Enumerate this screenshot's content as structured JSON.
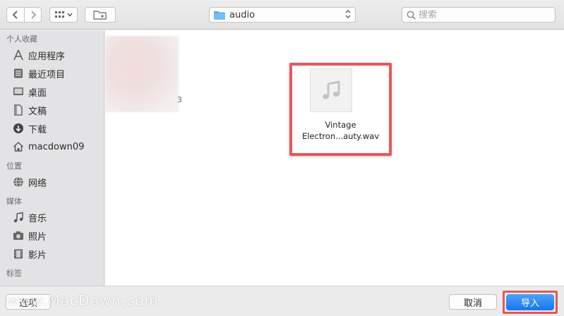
{
  "toolbar": {
    "back_icon": "chevron-left-icon",
    "forward_icon": "chevron-right-icon",
    "view_icon": "grid-view-icon",
    "new_folder_icon": "new-folder-icon",
    "location": "audio",
    "search_placeholder": "搜索"
  },
  "sidebar": {
    "favorites_title": "个人收藏",
    "favorites": [
      {
        "label": "应用程序",
        "icon": "applications-icon"
      },
      {
        "label": "最近项目",
        "icon": "recents-icon"
      },
      {
        "label": "桌面",
        "icon": "desktop-icon"
      },
      {
        "label": "文稿",
        "icon": "documents-icon"
      },
      {
        "label": "下载",
        "icon": "downloads-icon"
      },
      {
        "label": "macdown09",
        "icon": "home-icon"
      }
    ],
    "locations_title": "位置",
    "locations": [
      {
        "label": "网络",
        "icon": "network-icon"
      }
    ],
    "media_title": "媒体",
    "media": [
      {
        "label": "音乐",
        "icon": "music-icon"
      },
      {
        "label": "照片",
        "icon": "photos-icon"
      },
      {
        "label": "影片",
        "icon": "movies-icon"
      }
    ],
    "tags_title": "标签"
  },
  "main": {
    "blurred_suffix": "3",
    "selected_file": {
      "line1": "Vintage",
      "line2": "Electron...auty.wav",
      "icon": "audio-file-icon"
    }
  },
  "bottom": {
    "options_label": "选项",
    "cancel_label": "取消",
    "import_label": "导入"
  },
  "watermark": "www.MacDown.com",
  "colors": {
    "highlight": "#e4585a",
    "primary_button": "#1676f0",
    "folder": "#5aa9ef"
  }
}
